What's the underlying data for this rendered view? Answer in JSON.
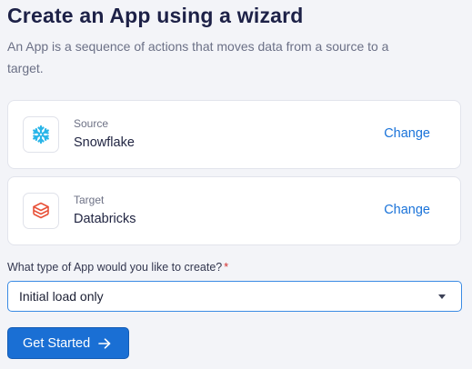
{
  "header": {
    "title": "Create an App using a wizard",
    "subtitle": "An App is a sequence of actions that moves data from a source to a target."
  },
  "source": {
    "label": "Source",
    "value": "Snowflake",
    "icon": "snowflake-icon",
    "icon_color": "#29b5e8",
    "change_label": "Change"
  },
  "target": {
    "label": "Target",
    "value": "Databricks",
    "icon": "databricks-icon",
    "icon_color": "#e8523a",
    "change_label": "Change"
  },
  "app_type": {
    "question": "What type of App would you like to create?",
    "required_mark": "*",
    "selected": "Initial load only"
  },
  "actions": {
    "get_started_label": "Get Started"
  },
  "colors": {
    "accent": "#1a73d9",
    "button": "#1a6fd4",
    "title": "#1d2147",
    "required": "#d32f2f"
  }
}
